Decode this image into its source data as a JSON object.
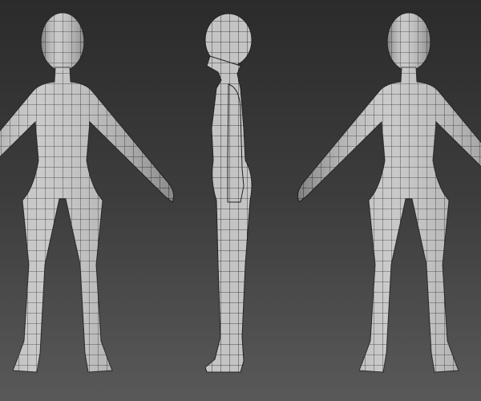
{
  "colors": {
    "background_top": "#2b2b2b",
    "background_bottom": "#595959",
    "mesh_surface": "#c4c4c4",
    "wire": "#1e1e1e"
  },
  "views": [
    {
      "id": "front"
    },
    {
      "id": "side"
    },
    {
      "id": "back"
    }
  ]
}
